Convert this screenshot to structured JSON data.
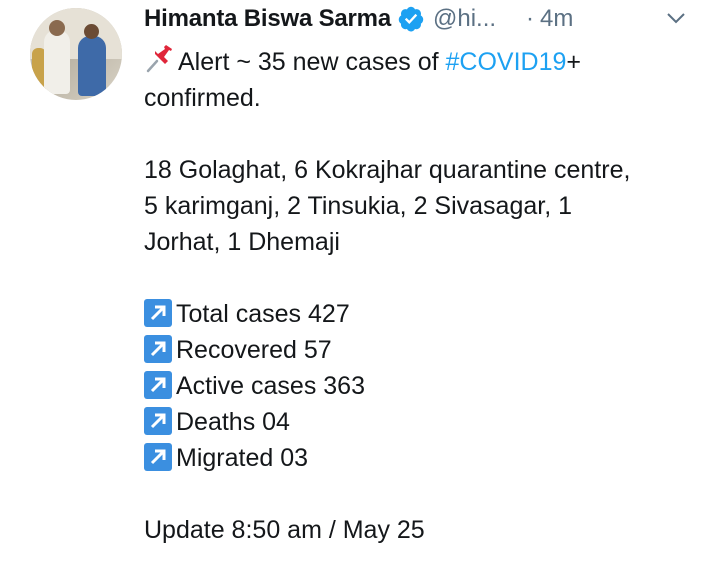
{
  "tweet": {
    "author_name": "Himanta Biswa Sarma",
    "handle": "@hi...",
    "separator": "·",
    "time": "4m",
    "line1_prefix": "Alert ~  35 new cases of ",
    "hashtag": "#COVID19",
    "line1_suffix": "+",
    "line2": "confirmed.",
    "districts_line1": "18 Golaghat, 6 Kokrajhar quarantine centre,",
    "districts_line2": "5 karimganj, 2 Tinsukia, 2 Sivasagar, 1",
    "districts_line3": "Jorhat, 1 Dhemaji",
    "stats": [
      "Total cases 427",
      "Recovered 57",
      "Active cases 363",
      "Deaths 04",
      "Migrated 03"
    ],
    "update": "Update 8:50 am / May 25"
  },
  "icons": {
    "verified": "verified-badge-icon",
    "menu": "chevron-down-icon",
    "pin": "pushpin-icon",
    "stat_marker": "arrow-up-right-icon"
  },
  "colors": {
    "hashtag": "#1da1f2",
    "verified": "#1da1f2",
    "secondary_text": "#5b7083",
    "arrow_box": "#3b8fe0"
  }
}
